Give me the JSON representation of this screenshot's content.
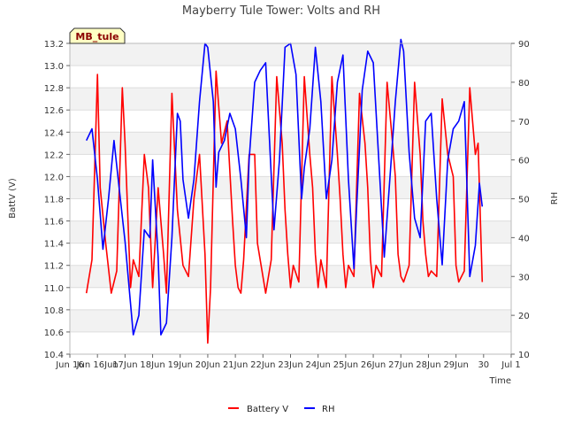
{
  "chart_data": {
    "type": "line",
    "title": "Mayberry Tule Tower: Volts and RH",
    "site_badge": "MB_tule",
    "xlabel": "Time",
    "ylabel_left": "BattV (V)",
    "ylabel_right": "RH",
    "x_range": [
      "Jun 15",
      "Jul 1"
    ],
    "x_tick_labels": [
      "Jun 16",
      "Jun 16Jun",
      "17Jun",
      "18Jun",
      "19Jun",
      "20Jun",
      "21Jun",
      "22Jun",
      "23Jun",
      "24Jun",
      "25Jun",
      "26Jun",
      "27Jun",
      "28Jun",
      "29Jun",
      "30",
      "Jul 1"
    ],
    "x_tick_days": [
      15,
      16,
      17,
      18,
      19,
      20,
      21,
      22,
      23,
      24,
      25,
      26,
      27,
      28,
      29,
      30,
      31
    ],
    "y_left_range": [
      10.4,
      13.2
    ],
    "y_left_ticks": [
      "10.4",
      "10.6",
      "10.8",
      "11.0",
      "11.2",
      "11.4",
      "11.6",
      "11.8",
      "12.0",
      "12.2",
      "12.4",
      "12.6",
      "12.8",
      "13.0",
      "13.2"
    ],
    "y_right_range": [
      10,
      90
    ],
    "y_right_ticks": [
      "10",
      "20",
      "30",
      "40",
      "50",
      "60",
      "70",
      "80",
      "90"
    ],
    "grid": "horizontal bands",
    "legend_position": "bottom-center",
    "series": [
      {
        "name": "Battery V",
        "axis": "left",
        "color": "#ff0000",
        "x": [
          15.6,
          15.8,
          16.0,
          16.1,
          16.3,
          16.5,
          16.7,
          16.9,
          17.0,
          17.2,
          17.3,
          17.5,
          17.7,
          17.85,
          18.0,
          18.2,
          18.4,
          18.5,
          18.7,
          18.9,
          19.1,
          19.3,
          19.5,
          19.7,
          19.9,
          20.0,
          20.1,
          20.3,
          20.5,
          20.7,
          20.9,
          21.0,
          21.1,
          21.2,
          21.3,
          21.5,
          21.7,
          21.8,
          22.0,
          22.1,
          22.3,
          22.5,
          22.7,
          22.8,
          22.9,
          23.0,
          23.1,
          23.3,
          23.5,
          23.7,
          23.8,
          23.9,
          24.0,
          24.1,
          24.3,
          24.5,
          24.7,
          24.8,
          24.9,
          25.0,
          25.1,
          25.3,
          25.5,
          25.7,
          25.8,
          25.9,
          26.0,
          26.1,
          26.3,
          26.5,
          26.7,
          26.8,
          26.9,
          27.0,
          27.1,
          27.3,
          27.5,
          27.7,
          27.8,
          27.9,
          28.0,
          28.1,
          28.3,
          28.5,
          28.7,
          28.9,
          29.0,
          29.1,
          29.3,
          29.5,
          29.7,
          29.8,
          29.95
        ],
        "y": [
          10.95,
          11.25,
          12.92,
          11.9,
          11.4,
          10.95,
          11.15,
          12.8,
          12.3,
          11.0,
          11.25,
          11.1,
          12.2,
          11.9,
          11.0,
          11.9,
          11.3,
          10.95,
          12.75,
          11.7,
          11.2,
          11.1,
          11.8,
          12.2,
          11.3,
          10.5,
          11.0,
          12.95,
          12.3,
          12.5,
          11.6,
          11.2,
          11.0,
          10.95,
          11.25,
          12.2,
          12.2,
          11.4,
          11.1,
          10.95,
          11.25,
          12.9,
          12.3,
          11.7,
          11.3,
          11.0,
          11.2,
          11.05,
          12.9,
          12.2,
          11.9,
          11.3,
          11.0,
          11.25,
          11.0,
          12.9,
          12.2,
          11.8,
          11.3,
          11.0,
          11.2,
          11.1,
          12.75,
          12.3,
          11.9,
          11.25,
          11.0,
          11.2,
          11.1,
          12.85,
          12.3,
          12.0,
          11.3,
          11.1,
          11.05,
          11.2,
          12.85,
          12.2,
          11.6,
          11.3,
          11.1,
          11.15,
          11.1,
          12.7,
          12.2,
          12.0,
          11.2,
          11.05,
          11.15,
          12.8,
          12.2,
          12.3,
          11.05
        ]
      },
      {
        "name": "RH",
        "axis": "right",
        "color": "#0000ff",
        "x": [
          15.6,
          15.8,
          16.0,
          16.2,
          16.4,
          16.6,
          16.8,
          17.0,
          17.2,
          17.3,
          17.5,
          17.7,
          17.9,
          18.0,
          18.2,
          18.3,
          18.5,
          18.7,
          18.9,
          19.0,
          19.1,
          19.3,
          19.5,
          19.7,
          19.9,
          20.0,
          20.2,
          20.3,
          20.4,
          20.6,
          20.8,
          21.0,
          21.2,
          21.4,
          21.5,
          21.7,
          21.9,
          22.1,
          22.3,
          22.4,
          22.6,
          22.8,
          23.0,
          23.2,
          23.4,
          23.5,
          23.7,
          23.9,
          24.1,
          24.3,
          24.5,
          24.7,
          24.9,
          25.1,
          25.3,
          25.4,
          25.6,
          25.8,
          26.0,
          26.2,
          26.4,
          26.6,
          26.8,
          27.0,
          27.1,
          27.3,
          27.5,
          27.7,
          27.9,
          28.1,
          28.3,
          28.5,
          28.7,
          28.9,
          29.1,
          29.3,
          29.5,
          29.7,
          29.85,
          29.95
        ],
        "y": [
          65,
          68,
          55,
          37,
          50,
          65,
          52,
          39,
          23,
          15,
          20,
          42,
          40,
          60,
          35,
          15,
          18,
          40,
          72,
          70,
          55,
          45,
          55,
          75,
          90,
          89,
          75,
          53,
          62,
          65,
          72,
          68,
          55,
          40,
          60,
          80,
          83,
          85,
          56,
          42,
          60,
          89,
          90,
          82,
          50,
          58,
          68,
          89,
          75,
          50,
          60,
          80,
          87,
          55,
          32,
          48,
          78,
          88,
          85,
          60,
          35,
          55,
          75,
          91,
          88,
          62,
          45,
          40,
          70,
          72,
          50,
          33,
          60,
          68,
          70,
          75,
          30,
          38,
          54,
          48
        ]
      }
    ]
  }
}
